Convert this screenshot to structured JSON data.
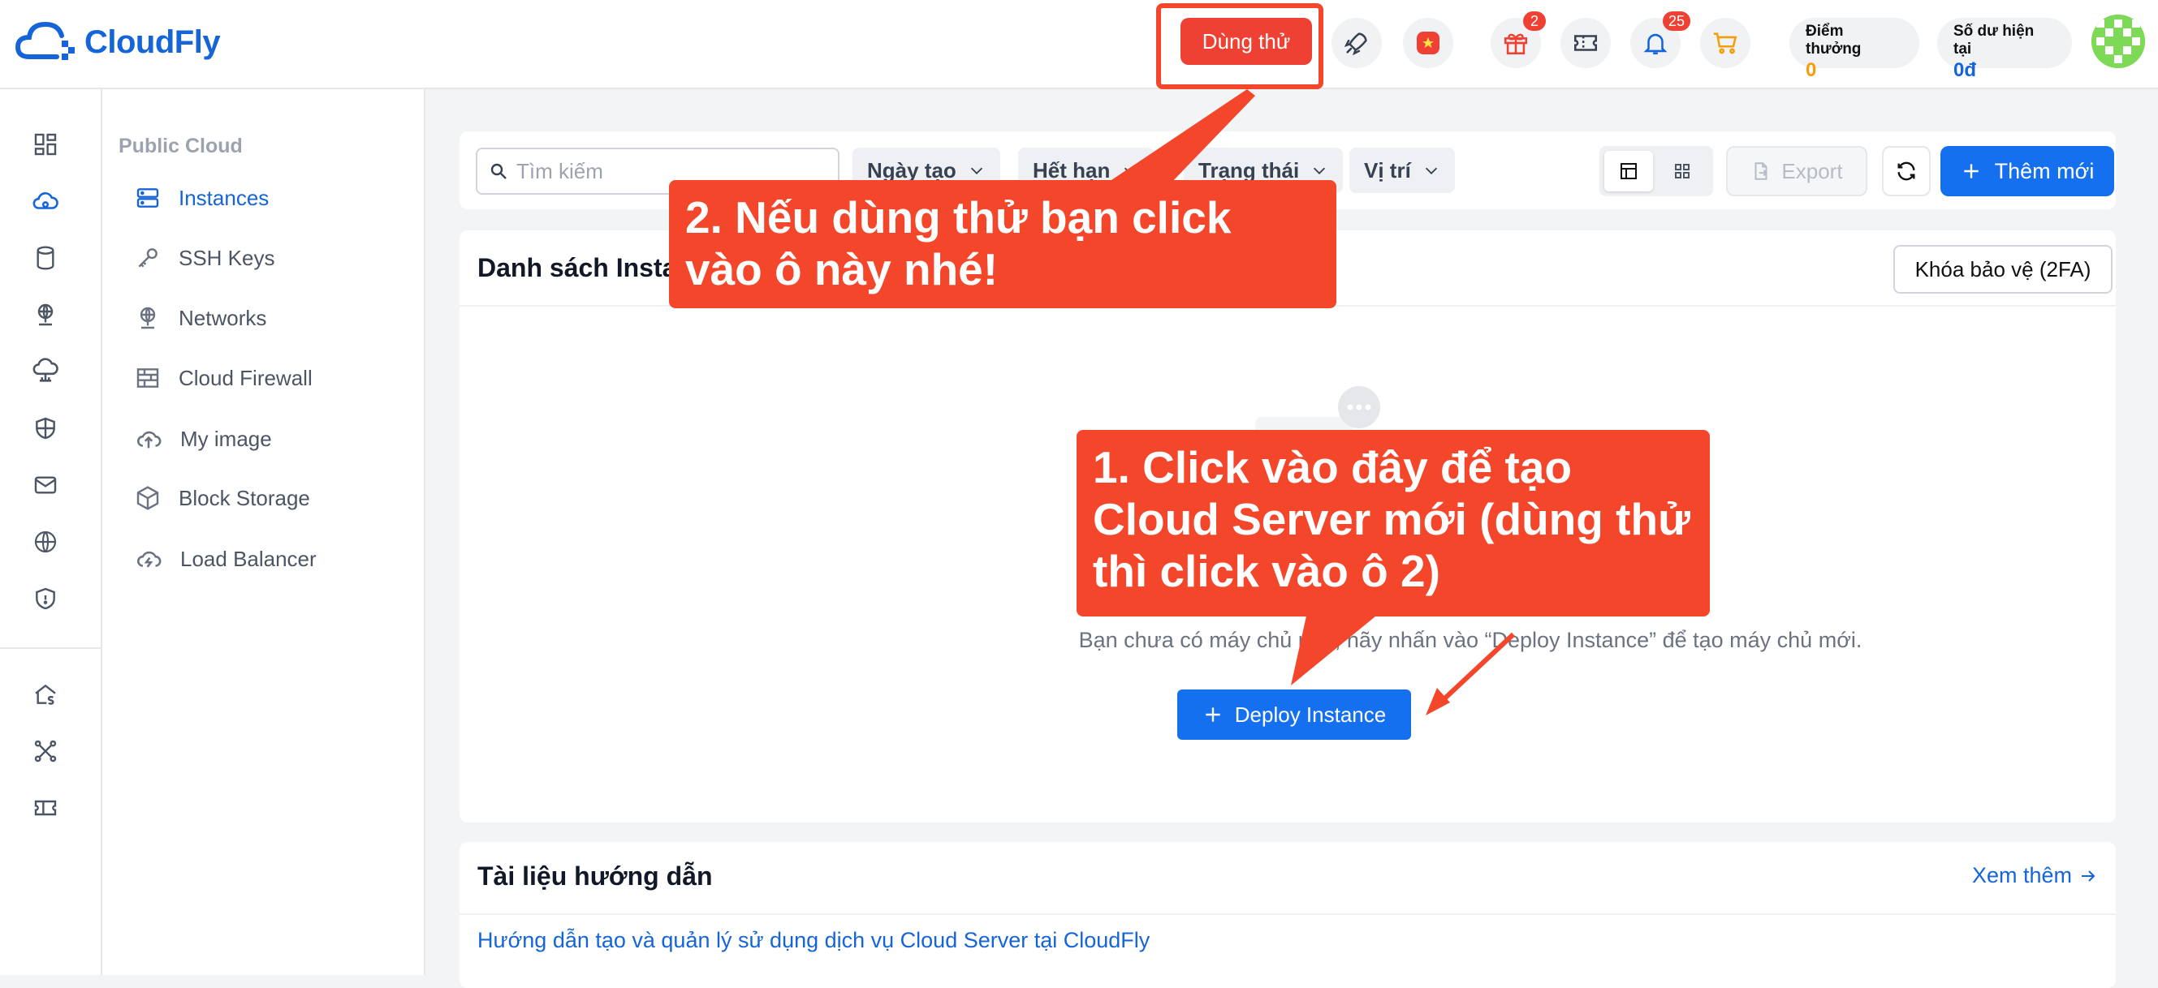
{
  "header": {
    "logo_text": "CloudFly",
    "trial_label": "Dùng thử",
    "gift_badge": "2",
    "bell_badge": "25",
    "points": {
      "label": "Điểm thưởng",
      "value": "0"
    },
    "balance": {
      "label": "Số dư hiện tại",
      "value": "0đ"
    }
  },
  "sidebar": {
    "section_title": "Public Cloud",
    "items": [
      {
        "label": "Instances",
        "icon": "server-icon",
        "active": true
      },
      {
        "label": "SSH Keys",
        "icon": "key-icon",
        "active": false
      },
      {
        "label": "Networks",
        "icon": "network-icon",
        "active": false
      },
      {
        "label": "Cloud Firewall",
        "icon": "firewall-icon",
        "active": false
      },
      {
        "label": "My image",
        "icon": "cloud-upload-icon",
        "active": false
      },
      {
        "label": "Block Storage",
        "icon": "cube-icon",
        "active": false
      },
      {
        "label": "Load Balancer",
        "icon": "cloud-sync-icon",
        "active": false
      }
    ]
  },
  "toolbar": {
    "search_placeholder": "Tìm kiếm",
    "filters": [
      "Ngày tạo",
      "Hết hạn",
      "Trạng thái",
      "Vị trí"
    ],
    "export_label": "Export",
    "add_label": "Thêm mới"
  },
  "instances_card": {
    "title": "Danh sách Instances",
    "twofa_label": "Khóa bảo vệ (2FA)",
    "empty_text": "Bạn chưa có máy chủ nào, hãy nhấn vào “Deploy Instance” để tạo máy chủ mới.",
    "deploy_label": "Deploy Instance"
  },
  "docs_card": {
    "title": "Tài liệu hướng dẫn",
    "see_more": "Xem thêm",
    "links": [
      "Hướng dẫn tạo và quản lý sử dụng dịch vụ Cloud Server tại CloudFly"
    ]
  },
  "callouts": {
    "trial": "2. Nếu dùng thử bạn click vào ô này nhé!",
    "deploy": "1. Click vào đây để tạo Cloud Server mới (dùng thử thì click vào ô 2)"
  },
  "colors": {
    "brand": "#1565d8",
    "primary_button": "#1570ef",
    "trial_button": "#ef4034",
    "callout": "#f4462a",
    "points_value": "#f59e0b"
  }
}
